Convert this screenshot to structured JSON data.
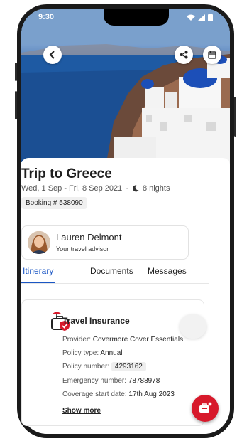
{
  "status": {
    "time": "9:30"
  },
  "trip": {
    "title": "Trip to Greece",
    "dates": "Wed, 1 Sep - Fri, 8 Sep 2021",
    "separator": "·",
    "nights": "8 nights",
    "booking": "Booking # 538090"
  },
  "advisor": {
    "name": "Lauren Delmont",
    "role": "Your travel advisor"
  },
  "tabs": [
    {
      "label": "Itinerary"
    },
    {
      "label": "Documents"
    },
    {
      "label": "Messages"
    }
  ],
  "insurance": {
    "title": "Travel Insurance",
    "provider_label": "Provider:",
    "provider": "Covermore Cover Essentials",
    "policy_type_label": "Policy type:",
    "policy_type": "Annual",
    "policy_number_label": "Policy number:",
    "policy_number": "4293162",
    "emergency_label": "Emergency number:",
    "emergency": "78788978",
    "start_label": "Coverage start date:",
    "start": "17th Aug 2023",
    "show_more": "Show more"
  },
  "colors": {
    "accent": "#1a56c4",
    "fab": "#d7192b"
  },
  "icons": [
    "back-arrow-icon",
    "share-icon",
    "calendar-icon",
    "moon-icon",
    "insurance-icon",
    "trip-icon"
  ]
}
